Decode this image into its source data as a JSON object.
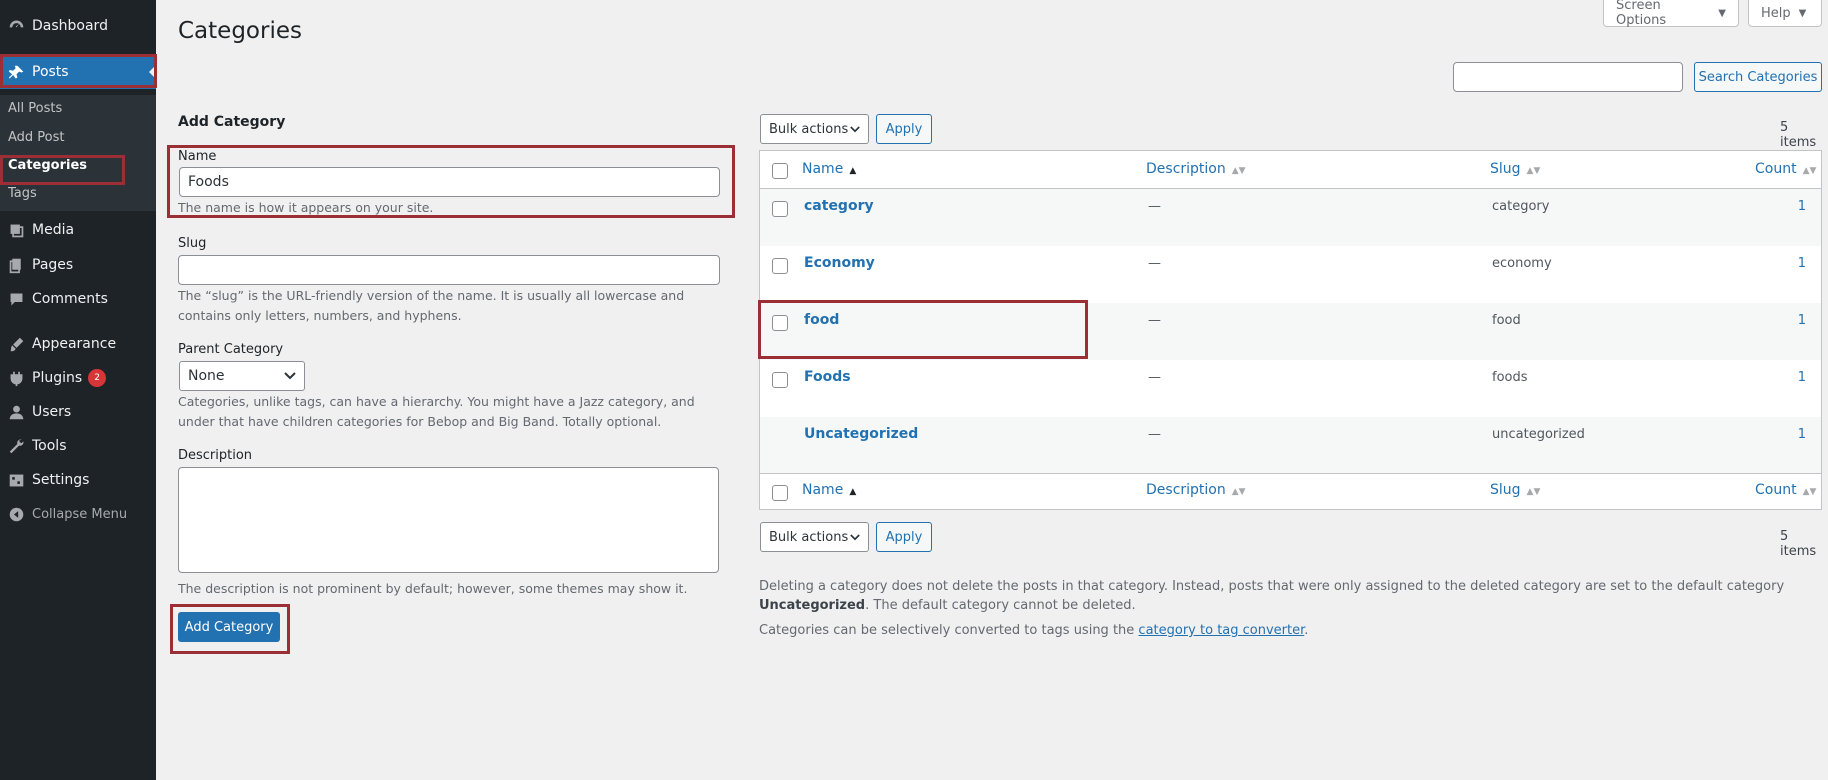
{
  "sidebar": {
    "items": {
      "dashboard": {
        "label": "Dashboard",
        "icon": "dashboard-icon"
      },
      "posts": {
        "label": "Posts",
        "icon": "pin-icon"
      },
      "media": {
        "label": "Media",
        "icon": "media-icon"
      },
      "pages": {
        "label": "Pages",
        "icon": "pages-icon"
      },
      "comments": {
        "label": "Comments",
        "icon": "comments-icon"
      },
      "appearance": {
        "label": "Appearance",
        "icon": "brush-icon"
      },
      "plugins": {
        "label": "Plugins",
        "icon": "plug-icon",
        "badge": "2"
      },
      "users": {
        "label": "Users",
        "icon": "user-icon"
      },
      "tools": {
        "label": "Tools",
        "icon": "wrench-icon"
      },
      "settings": {
        "label": "Settings",
        "icon": "settings-icon"
      },
      "collapse": {
        "label": "Collapse Menu",
        "icon": "collapse-icon"
      }
    },
    "submenu": {
      "all_posts": "All Posts",
      "add_post": "Add Post",
      "categories": "Categories",
      "tags": "Tags"
    }
  },
  "header": {
    "screen_options": "Screen Options",
    "help": "Help",
    "title": "Categories"
  },
  "search": {
    "value": "",
    "button": "Search Categories"
  },
  "form": {
    "heading": "Add Category",
    "name_label": "Name",
    "name_value": "Foods",
    "name_help": "The name is how it appears on your site.",
    "slug_label": "Slug",
    "slug_value": "",
    "slug_help": "The “slug” is the URL-friendly version of the name. It is usually all lowercase and contains only letters, numbers, and hyphens.",
    "parent_label": "Parent Category",
    "parent_value": "None",
    "parent_help": "Categories, unlike tags, can have a hierarchy. You might have a Jazz category, and under that have children categories for Bebop and Big Band. Totally optional.",
    "desc_label": "Description",
    "desc_help": "The description is not prominent by default; however, some themes may show it.",
    "submit": "Add Category"
  },
  "table": {
    "bulk_actions": "Bulk actions",
    "apply": "Apply",
    "items_count": "5 items",
    "columns": {
      "name": "Name",
      "description": "Description",
      "slug": "Slug",
      "count": "Count"
    },
    "rows": [
      {
        "name": "category",
        "description": "—",
        "slug": "category",
        "count": "1"
      },
      {
        "name": "Economy",
        "description": "—",
        "slug": "economy",
        "count": "1"
      },
      {
        "name": "food",
        "description": "—",
        "slug": "food",
        "count": "1"
      },
      {
        "name": "Foods",
        "description": "—",
        "slug": "foods",
        "count": "1"
      },
      {
        "name": "Uncategorized",
        "description": "—",
        "slug": "uncategorized",
        "count": "1"
      }
    ]
  },
  "notes": {
    "delete_note_start": "Deleting a category does not delete the posts in that category. Instead, posts that were only assigned to the deleted category are set to the default category ",
    "delete_note_bold": "Uncategorized",
    "delete_note_end": ". The default category cannot be deleted.",
    "convert_note_start": "Categories can be selectively converted to tags using the ",
    "convert_link": "category to tag converter",
    "convert_note_end": "."
  },
  "colors": {
    "sidebar_bg": "#1d2327",
    "accent": "#2271b1",
    "highlight": "#9b2f35",
    "badge": "#d63638"
  }
}
